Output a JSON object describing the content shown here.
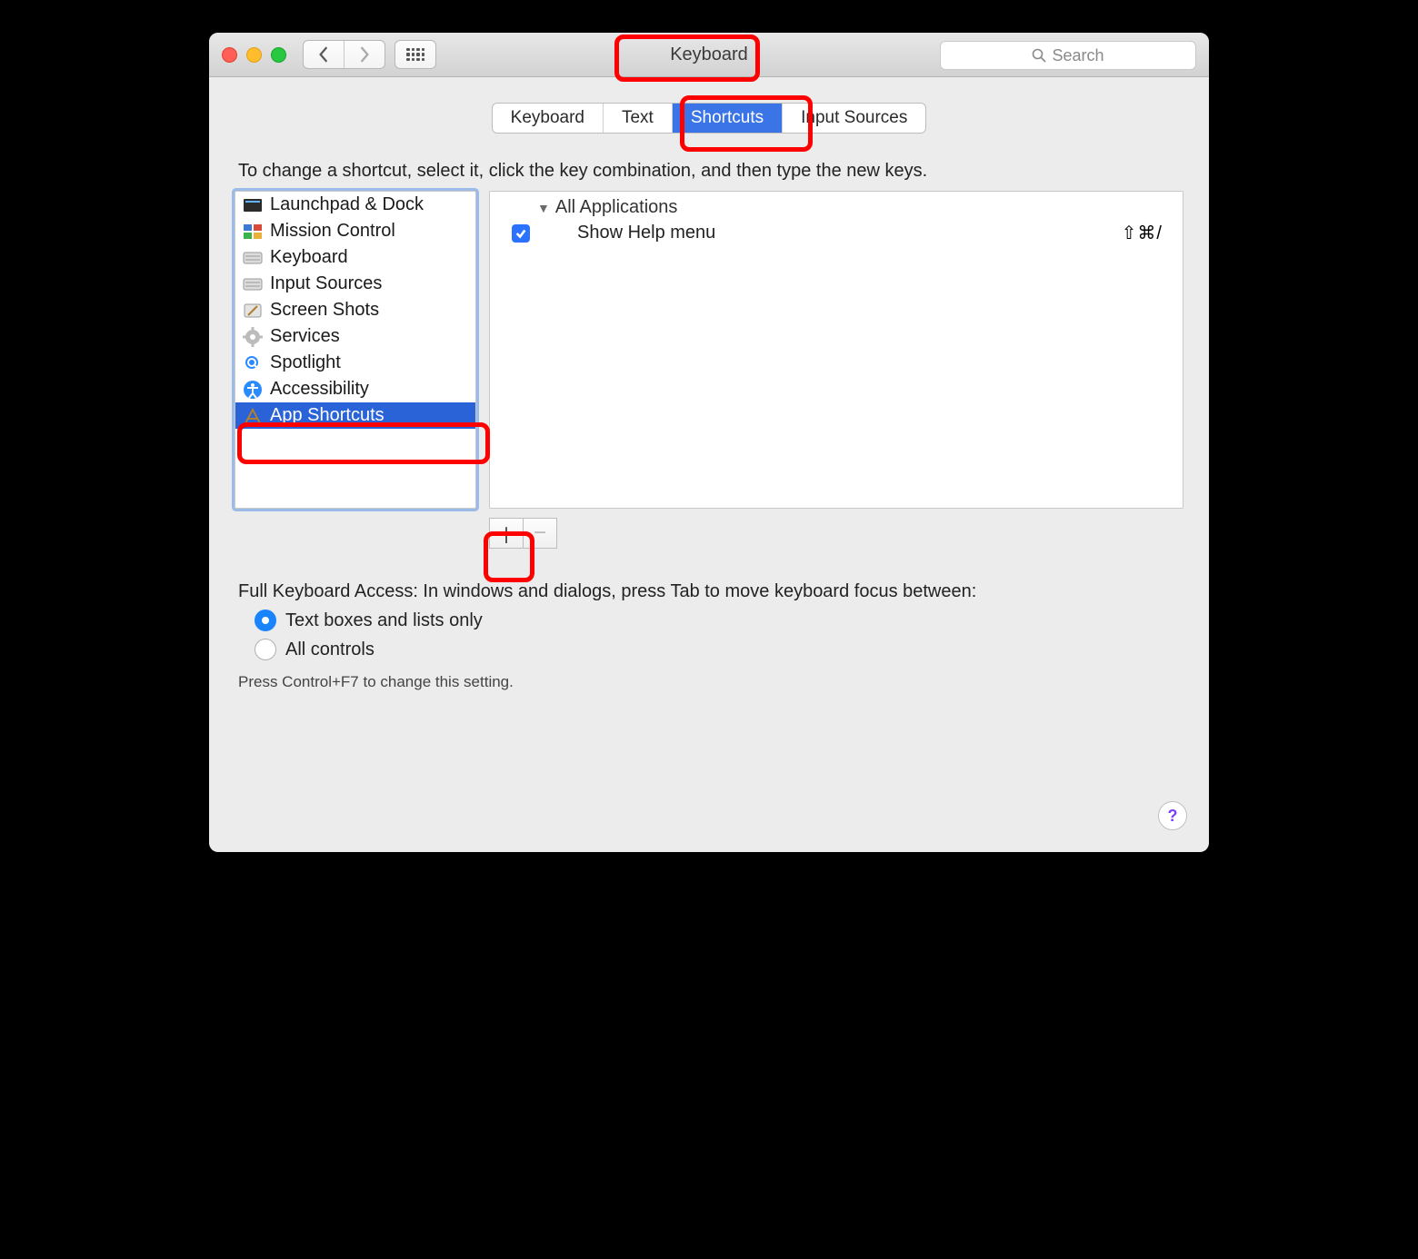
{
  "window": {
    "title": "Keyboard"
  },
  "toolbar": {
    "search_placeholder": "Search"
  },
  "tabs": [
    "Keyboard",
    "Text",
    "Shortcuts",
    "Input Sources"
  ],
  "active_tab_index": 2,
  "instruction": "To change a shortcut, select it, click the key combination, and then type the new keys.",
  "categories": [
    {
      "label": "Launchpad & Dock",
      "icon": "launchpad"
    },
    {
      "label": "Mission Control",
      "icon": "mission"
    },
    {
      "label": "Keyboard",
      "icon": "keyboard"
    },
    {
      "label": "Input Sources",
      "icon": "keyboard"
    },
    {
      "label": "Screen Shots",
      "icon": "screenshot"
    },
    {
      "label": "Services",
      "icon": "services"
    },
    {
      "label": "Spotlight",
      "icon": "spotlight"
    },
    {
      "label": "Accessibility",
      "icon": "accessibility"
    },
    {
      "label": "App Shortcuts",
      "icon": "appshortcuts"
    }
  ],
  "selected_category_index": 8,
  "detail": {
    "group": "All Applications",
    "items": [
      {
        "checked": true,
        "label": "Show Help menu",
        "shortcut": "⇧⌘/"
      }
    ]
  },
  "buttons": {
    "add": "＋",
    "remove": "−"
  },
  "footer": {
    "heading": "Full Keyboard Access: In windows and dialogs, press Tab to move keyboard focus between:",
    "options": [
      "Text boxes and lists only",
      "All controls"
    ],
    "selected_option_index": 0,
    "hint": "Press Control+F7 to change this setting."
  },
  "help": "?"
}
